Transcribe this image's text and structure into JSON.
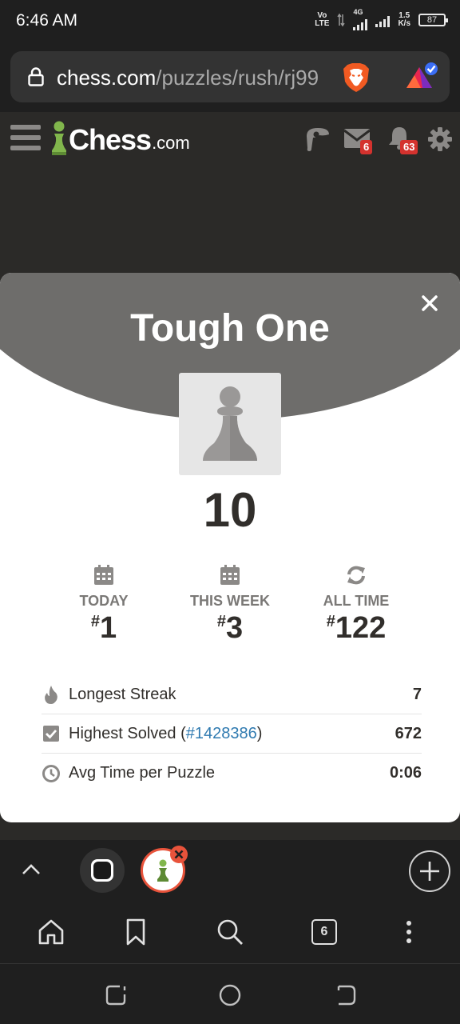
{
  "status_bar": {
    "time": "6:46 AM",
    "volte": "Vo",
    "lte": "LTE",
    "network": "4G",
    "speed_value": "1.5",
    "speed_unit": "K/s",
    "battery": "87"
  },
  "browser": {
    "url_domain": "chess.com",
    "url_path": "/puzzles/rush/rj99",
    "tab_count": "6"
  },
  "site_header": {
    "logo_text": "Chess",
    "logo_domain": ".com",
    "messages_badge": "6",
    "notifications_badge": "63"
  },
  "modal": {
    "title": "Tough One",
    "score": "10",
    "ranks": [
      {
        "label": "TODAY",
        "hash": "#",
        "value": "1",
        "icon": "calendar-icon"
      },
      {
        "label": "THIS WEEK",
        "hash": "#",
        "value": "3",
        "icon": "calendar-icon"
      },
      {
        "label": "ALL TIME",
        "hash": "#",
        "value": "122",
        "icon": "refresh-icon"
      }
    ],
    "stats": [
      {
        "label": "Longest Streak",
        "value": "7",
        "icon": "flame-icon"
      },
      {
        "label_prefix": "Highest Solved (",
        "link": "#1428386",
        "label_suffix": ")",
        "value": "672",
        "icon": "checkbox-icon"
      },
      {
        "label": "Avg Time per Puzzle",
        "value": "0:06",
        "icon": "clock-icon"
      }
    ]
  },
  "colors": {
    "page_bg": "#2b2a28",
    "modal_header": "#6e6d6b",
    "chess_green": "#81b64c",
    "badge_red": "#d4322e",
    "link_blue": "#2f7ab0"
  }
}
